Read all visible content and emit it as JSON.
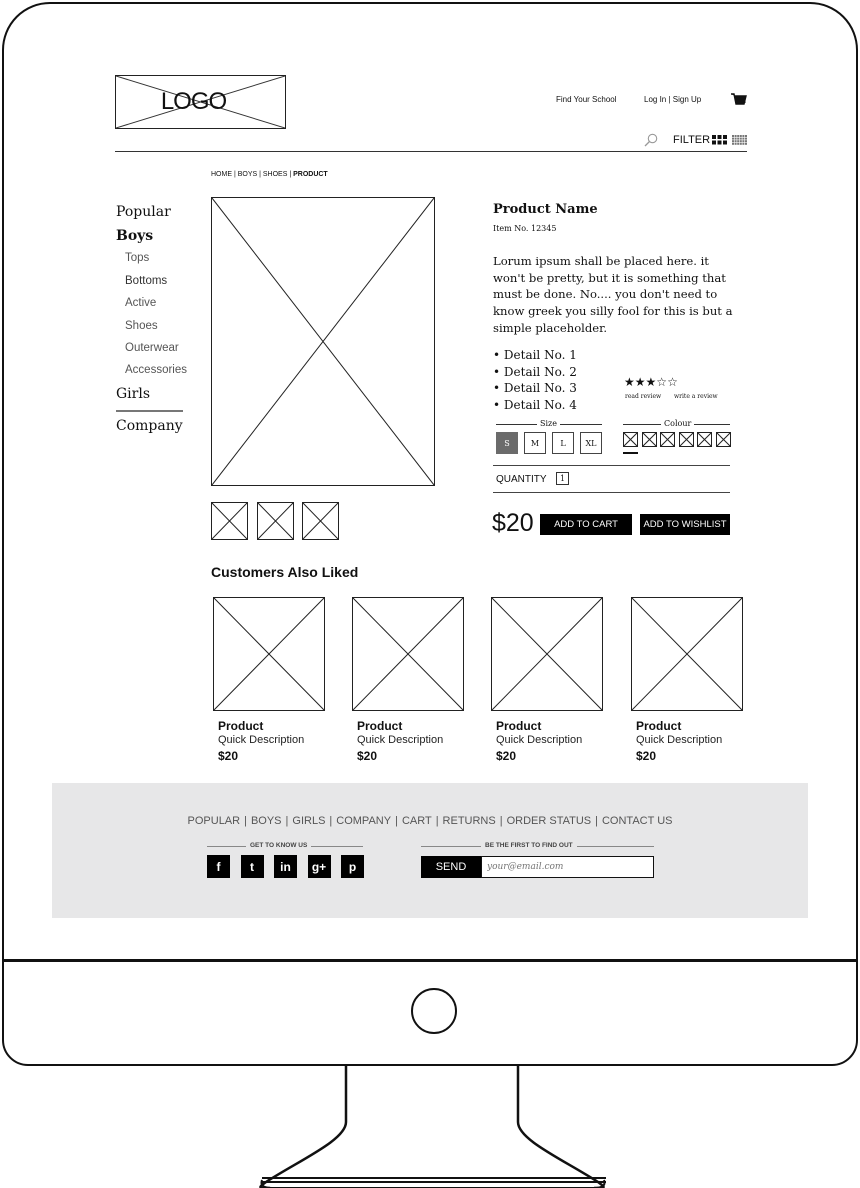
{
  "header": {
    "logo_text": "LOGO",
    "find_school": "Find Your School",
    "login_signup": "Log In | Sign Up",
    "filter_label": "FILTER"
  },
  "breadcrumb": {
    "path": "HOME | BOYS | SHOES | ",
    "current": "PRODUCT"
  },
  "sidebar": {
    "popular": "Popular",
    "boys": "Boys",
    "boys_items": [
      "Tops",
      "Bottoms",
      "Active",
      "Shoes",
      "Outerwear",
      "Accessories"
    ],
    "girls": "Girls",
    "company": "Company"
  },
  "product": {
    "name": "Product Name",
    "item_no": "Item No. 12345",
    "description": "Lorum ipsum shall be placed here. it won't be pretty, but it is something that must be done. No.... you don't need to know greek you silly fool for this is but a simple placeholder.",
    "details": [
      "• Detail No. 1",
      "• Detail No. 2",
      "• Detail No. 3",
      "• Detail No. 4"
    ],
    "rating": {
      "value": 3,
      "max": 5,
      "filled_star": "★",
      "empty_star": "☆"
    },
    "read_review": "read review",
    "write_review": "write a review",
    "size_label": "Size",
    "sizes": [
      "S",
      "M",
      "L",
      "XL"
    ],
    "selected_size": "S",
    "colour_label": "Colour",
    "colour_count": 6,
    "selected_colour_index": 0,
    "quantity_label": "QUANTITY",
    "quantity": "1",
    "price": "$20",
    "add_to_cart": "ADD TO CART",
    "add_to_wishlist": "ADD TO WISHLIST"
  },
  "also_liked": {
    "title": "Customers Also Liked",
    "items": [
      {
        "title": "Product",
        "desc": "Quick Description",
        "price": "$20"
      },
      {
        "title": "Product",
        "desc": "Quick Description",
        "price": "$20"
      },
      {
        "title": "Product",
        "desc": "Quick Description",
        "price": "$20"
      },
      {
        "title": "Product",
        "desc": "Quick Description",
        "price": "$20"
      }
    ]
  },
  "footer": {
    "links": [
      "POPULAR",
      "BOYS",
      "GIRLS",
      "COMPANY",
      "CART",
      "RETURNS",
      "ORDER STATUS",
      "CONTACT US"
    ],
    "get_to_know": "GET TO KNOW US",
    "social": [
      {
        "name": "facebook",
        "glyph": "f"
      },
      {
        "name": "twitter",
        "glyph": "t"
      },
      {
        "name": "linkedin",
        "glyph": "in"
      },
      {
        "name": "google-plus",
        "glyph": "g+"
      },
      {
        "name": "pinterest",
        "glyph": "p"
      }
    ],
    "first_to_find": "BE THE FIRST TO FIND OUT",
    "send_label": "SEND",
    "email_placeholder": "your@email.com"
  },
  "colors": {
    "footer_bg": "#e7e7e8",
    "selected_size_bg": "#6b6b6b",
    "button_bg": "#000000"
  }
}
